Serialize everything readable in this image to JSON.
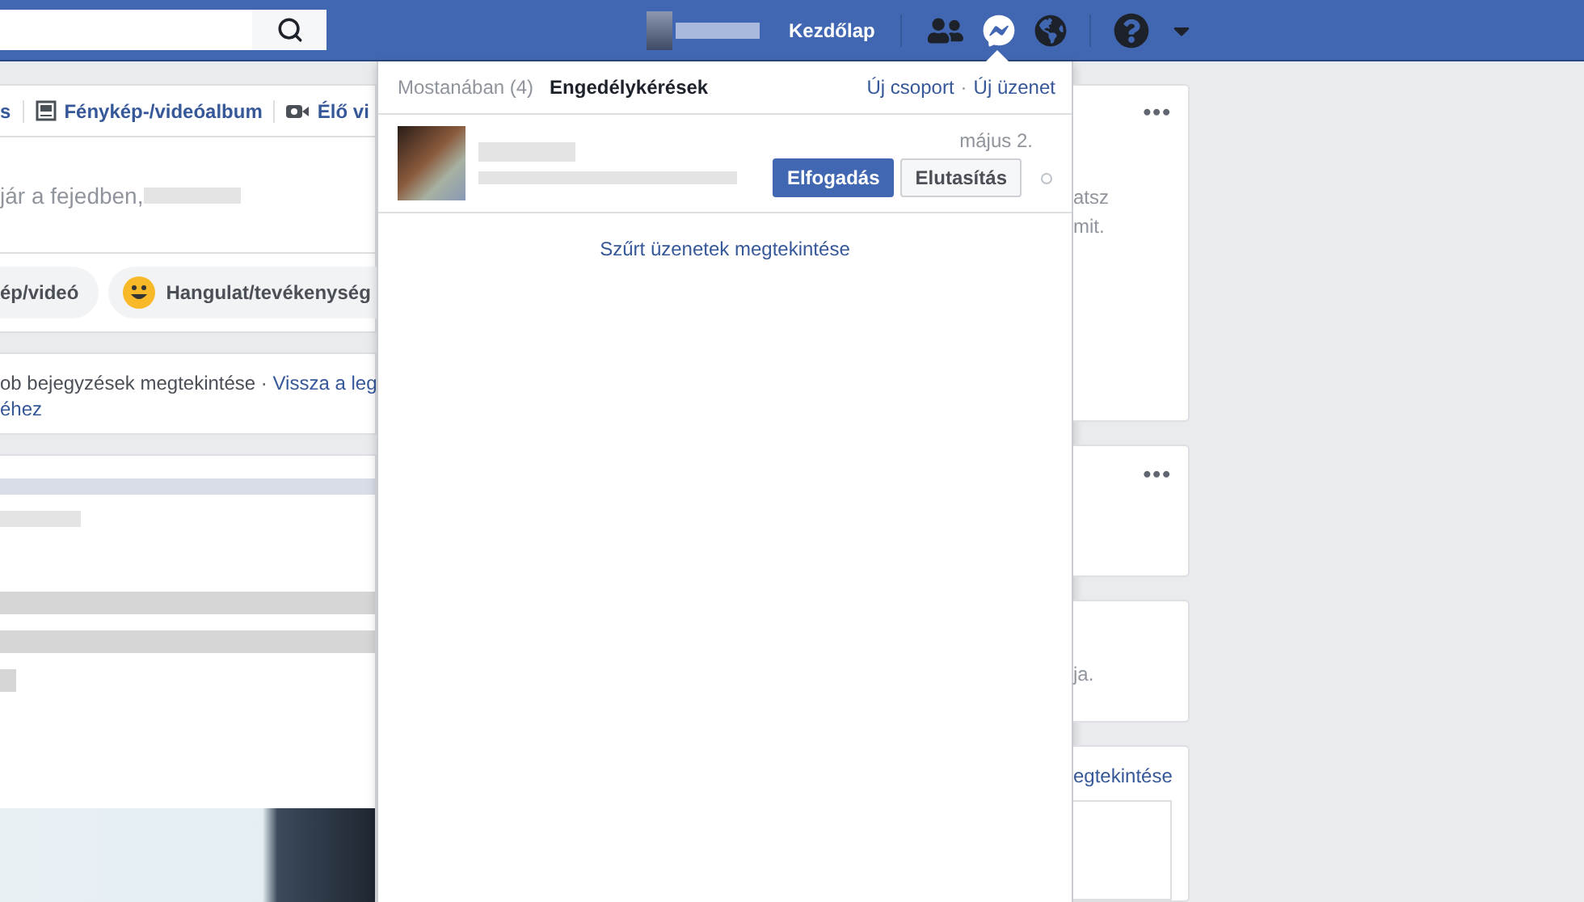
{
  "top_bar": {
    "home_link": "Kezdőlap",
    "nav_icons": [
      {
        "kind": "friends",
        "selected": false
      },
      {
        "kind": "messenger",
        "selected": true
      },
      {
        "kind": "globe",
        "selected": false
      },
      {
        "kind": "help",
        "selected": false
      },
      {
        "kind": "caret",
        "selected": false
      }
    ]
  },
  "composer": {
    "tabs": [
      {
        "kind": "text",
        "label": "s"
      },
      {
        "kind": "album",
        "label": "Fénykép-/videóalbum"
      },
      {
        "kind": "live",
        "label": "Élő vi"
      }
    ],
    "prompt": "jár a fejedben,",
    "actions": [
      {
        "kind": "photo",
        "label": "ép/videó"
      },
      {
        "kind": "feeling",
        "label": "Hangulat/tevékenység"
      }
    ]
  },
  "feed_notice": {
    "text": "ob bejegyzések megtekintése · ",
    "link": "Vissza a leg",
    "link_continued": "éhez"
  },
  "messages_dropdown": {
    "tabs": [
      {
        "label": "Mostanában (4)",
        "selected": false
      },
      {
        "label": "Engedélykérések",
        "selected": true
      }
    ],
    "actions": [
      "Új csoport",
      "Új üzenet"
    ],
    "actions_separator": "·",
    "requests": [
      {
        "date": "május 2.",
        "accept": "Elfogadás",
        "decline": "Elutasítás"
      }
    ],
    "footer_link": "Szűrt üzenetek megtekintése"
  },
  "right_column": {
    "cards": [
      {
        "kind": "menu",
        "more": "•••",
        "lines": [
          "atsz",
          "mit."
        ]
      },
      {
        "kind": "menu",
        "more": "•••"
      },
      {
        "kind": "plain",
        "lines": [
          "ja."
        ]
      },
      {
        "kind": "link",
        "lines": [
          "egtekintése"
        ]
      }
    ]
  }
}
